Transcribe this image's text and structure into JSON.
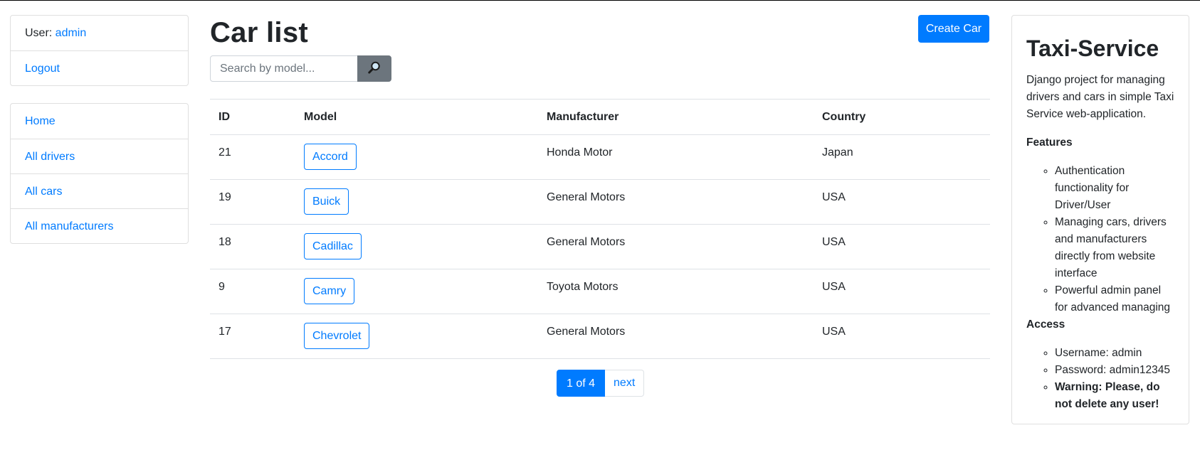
{
  "sidebar": {
    "user_label": "User: ",
    "username": "admin",
    "logout": "Logout",
    "nav": [
      {
        "label": "Home"
      },
      {
        "label": "All drivers"
      },
      {
        "label": "All cars"
      },
      {
        "label": "All manufacturers"
      }
    ]
  },
  "main": {
    "title": "Car list",
    "create_button": "Create Car",
    "search": {
      "placeholder": "Search by model...",
      "value": "",
      "icon": "search-icon"
    },
    "table": {
      "headers": [
        "ID",
        "Model",
        "Manufacturer",
        "Country"
      ],
      "rows": [
        {
          "id": "21",
          "model": "Accord",
          "manufacturer": "Honda Motor",
          "country": "Japan"
        },
        {
          "id": "19",
          "model": "Buick",
          "manufacturer": "General Motors",
          "country": "USA"
        },
        {
          "id": "18",
          "model": "Cadillac",
          "manufacturer": "General Motors",
          "country": "USA"
        },
        {
          "id": "9",
          "model": "Camry",
          "manufacturer": "Toyota Motors",
          "country": "USA"
        },
        {
          "id": "17",
          "model": "Chevrolet",
          "manufacturer": "General Motors",
          "country": "USA"
        }
      ]
    },
    "pagination": {
      "current": "1 of 4",
      "next": "next"
    }
  },
  "info": {
    "title": "Taxi-Service",
    "description": "Django project for managing drivers and cars in simple Taxi Service web-application.",
    "features_title": "Features",
    "features": [
      "Authentication functionality for Driver/User",
      "Managing cars, drivers and manufacturers directly from website interface",
      "Powerful admin panel for advanced managing"
    ],
    "access_title": "Access",
    "access": [
      "Username: admin",
      "Password: admin12345"
    ],
    "warning": "Warning: Please, do not delete any user!"
  },
  "colors": {
    "primary": "#007bff",
    "secondary": "#6c757d",
    "border": "#dee2e6"
  }
}
